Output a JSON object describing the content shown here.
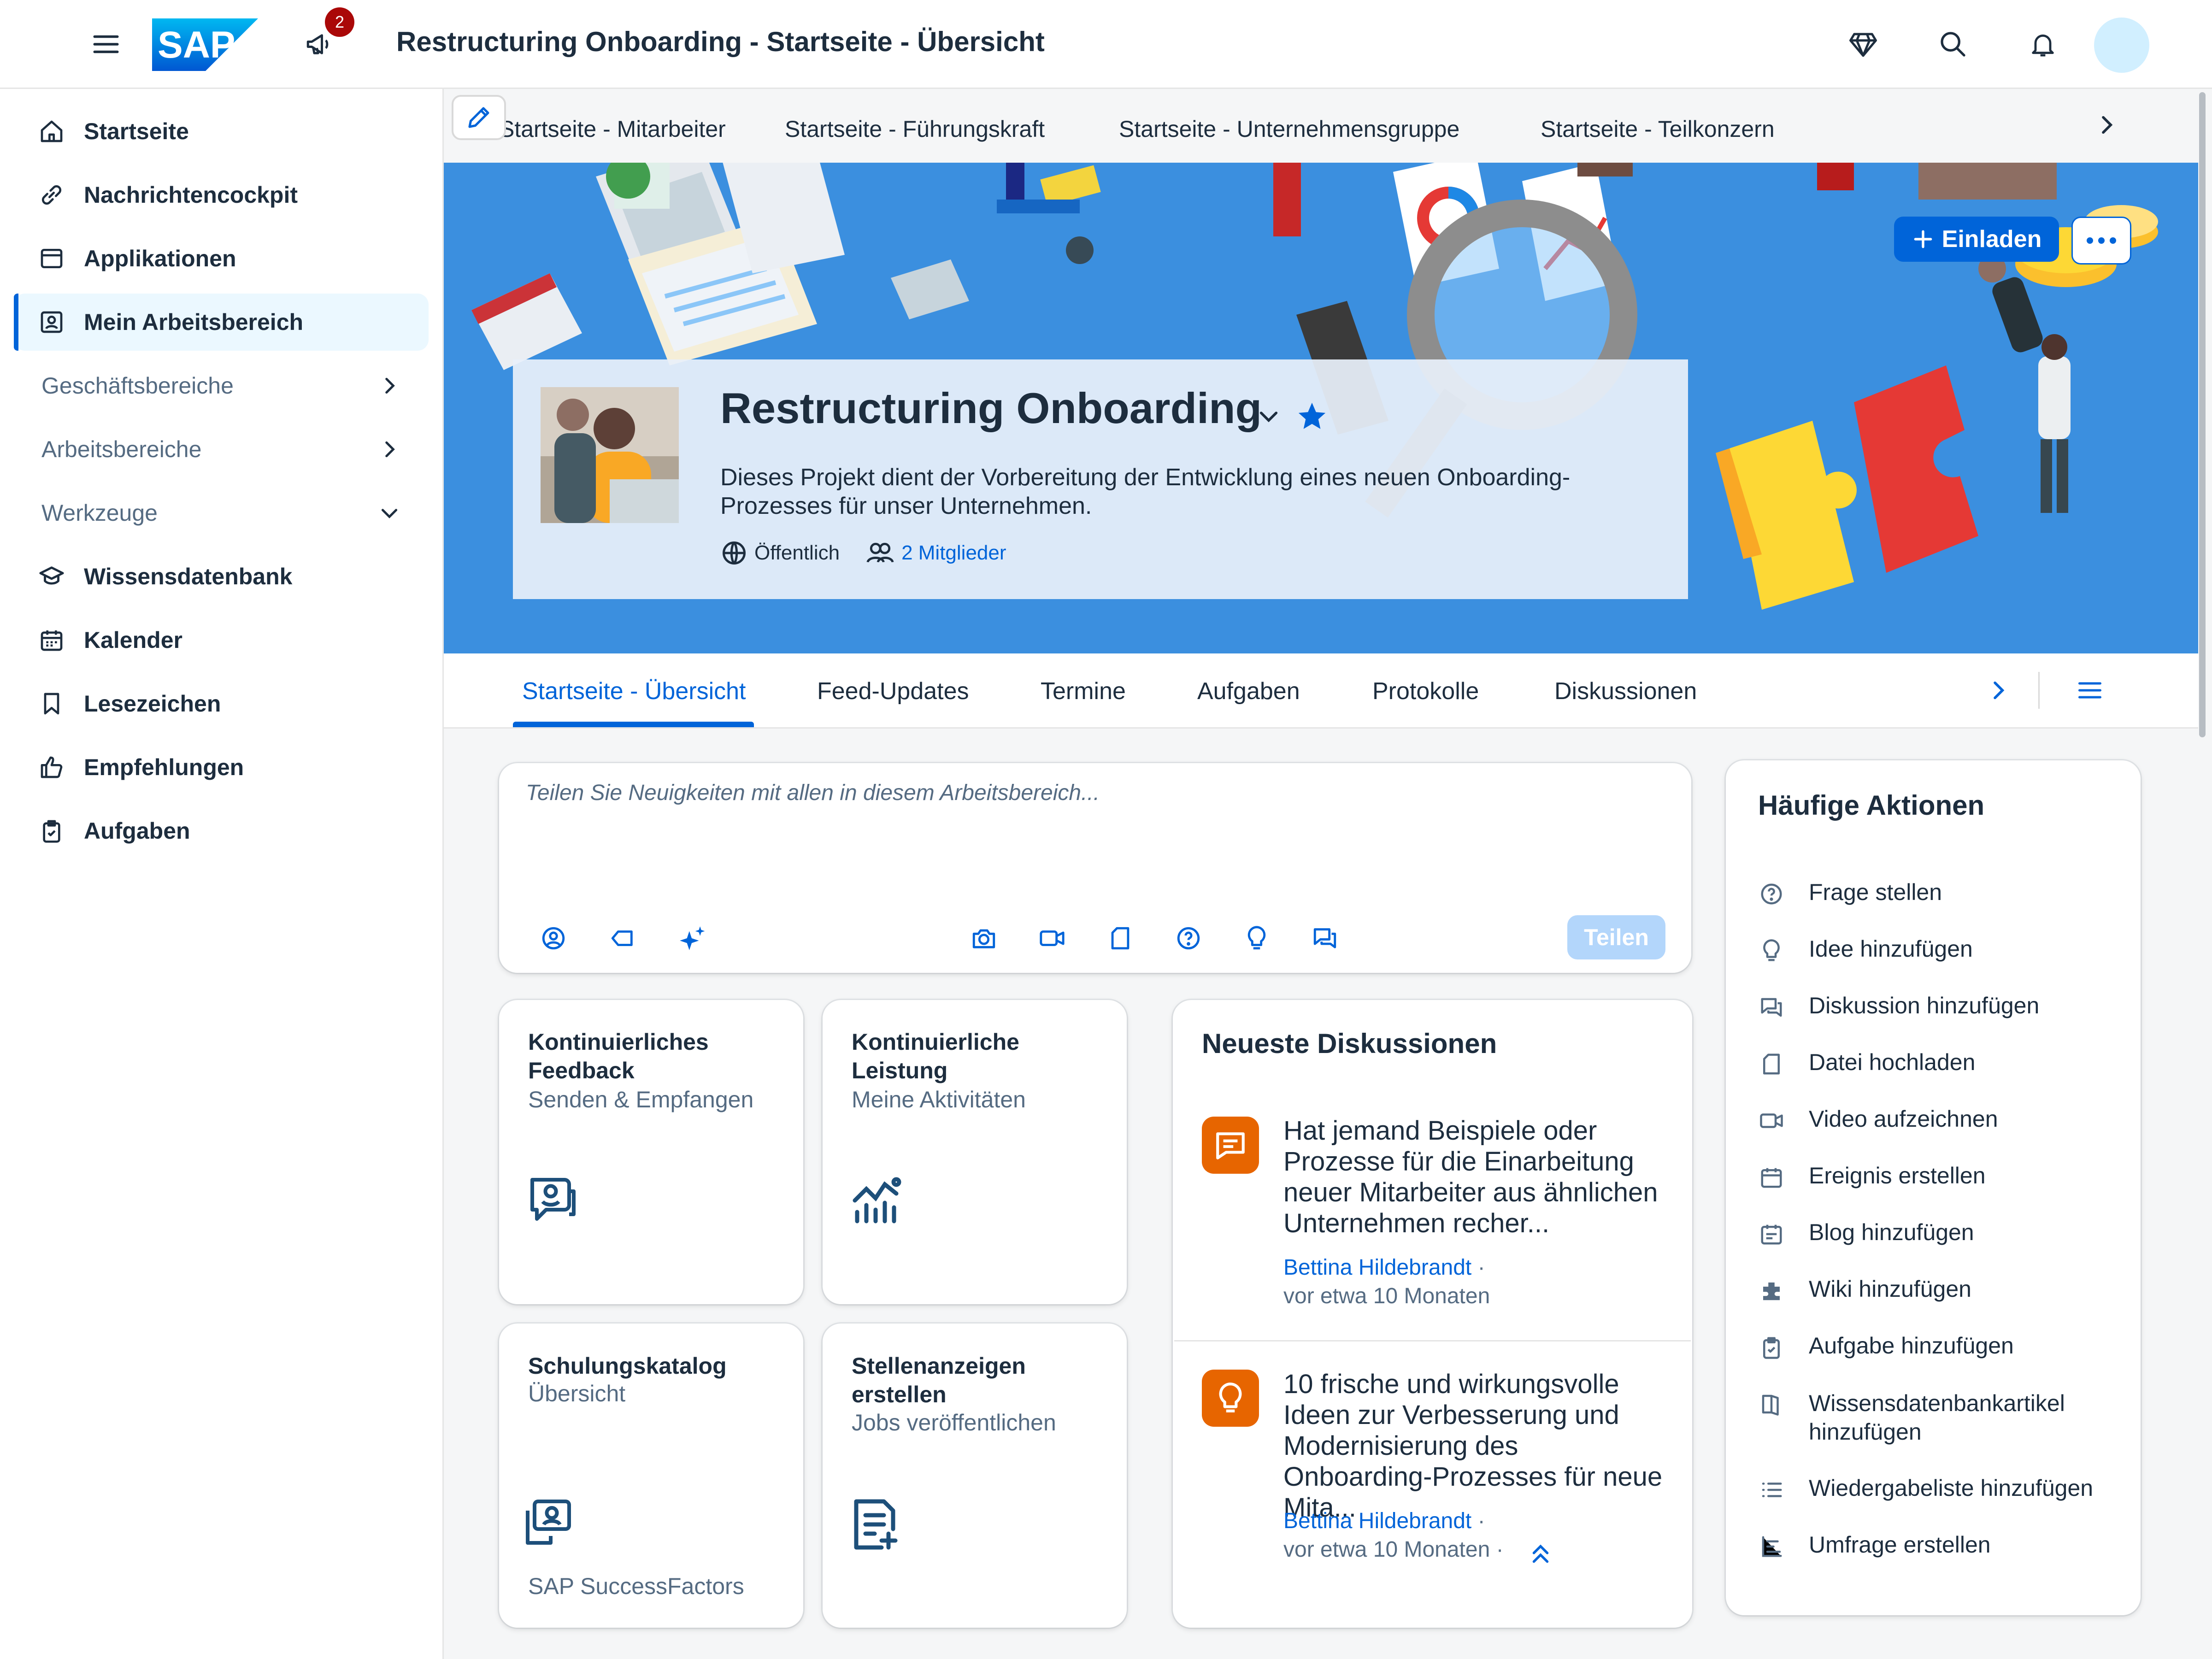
{
  "shell": {
    "title": "Restructuring Onboarding - Startseite - Übersicht",
    "logo_text": "SAP",
    "notification_count": "2",
    "accent": "#0064d9",
    "icons": [
      "menu-icon",
      "megaphone-icon",
      "diamond-icon",
      "search-icon",
      "bell-icon"
    ]
  },
  "sidebar": {
    "items": [
      {
        "label": "Startseite",
        "icon": "home-icon"
      },
      {
        "label": "Nachrichtencockpit",
        "icon": "link-icon"
      },
      {
        "label": "Applikationen",
        "icon": "app-window-icon"
      },
      {
        "label": "Mein Arbeitsbereich",
        "icon": "workspace-icon",
        "selected": true
      },
      {
        "label": "Geschäftsbereiche",
        "group": true,
        "chevron": "right"
      },
      {
        "label": "Arbeitsbereiche",
        "group": true,
        "chevron": "right"
      },
      {
        "label": "Werkzeuge",
        "group": true,
        "chevron": "down"
      },
      {
        "label": "Wissensdatenbank",
        "icon": "education-icon"
      },
      {
        "label": "Kalender",
        "icon": "calendar-icon"
      },
      {
        "label": "Lesezeichen",
        "icon": "bookmark-icon"
      },
      {
        "label": "Empfehlungen",
        "icon": "thumb-up-icon"
      },
      {
        "label": "Aufgaben",
        "icon": "task-icon"
      }
    ]
  },
  "subnav": {
    "tabs": [
      "Startseite - Mitarbeiter",
      "Startseite - Führungskraft",
      "Startseite - Unternehmensgruppe",
      "Startseite - Teilkonzern"
    ]
  },
  "workspace": {
    "title": "Restructuring Onboarding",
    "description": "Dieses Projekt dient der Vorbereitung der Entwicklung eines neuen Onboarding-Prozesses für unser Unternehmen.",
    "visibility": "Öffentlich",
    "members": "2 Mitglieder",
    "invite_label": "Einladen",
    "favorite": true
  },
  "tabs": {
    "items": [
      "Startseite - Übersicht",
      "Feed-Updates",
      "Termine",
      "Aufgaben",
      "Protokolle",
      "Diskussionen"
    ],
    "active": 0
  },
  "composer": {
    "placeholder": "Teilen Sie Neuigkeiten mit allen in diesem Arbeitsbereich...",
    "share_label": "Teilen"
  },
  "tiles": [
    {
      "title": "Kontinuierliches Feedback",
      "subtitle": "Senden & Empfangen",
      "icon": "feedback-icon",
      "footer": ""
    },
    {
      "title": "Kontinuierliche Leistung",
      "subtitle": "Meine Aktivitäten",
      "icon": "performance-chart-icon",
      "footer": ""
    },
    {
      "title": "Schulungskatalog",
      "subtitle": "Übersicht",
      "icon": "learning-icon",
      "footer": "SAP SuccessFactors"
    },
    {
      "title": "Stellenanzeigen erstellen",
      "subtitle": "Jobs veröffentlichen",
      "icon": "add-document-icon",
      "footer": ""
    }
  ],
  "discussions": {
    "title": "Neueste Diskussionen",
    "items": [
      {
        "text": "Hat jemand Beispiele oder Prozesse für die Einarbeitung neuer Mitarbeiter aus ähnlichen Unternehmen recher...",
        "author": "Bettina Hildebrandt",
        "time": "vor etwa 10 Monaten",
        "icon": "discussion-icon"
      },
      {
        "text": "10 frische und wirkungsvolle Ideen zur Verbesserung und Modernisierung des Onboarding-Prozesses für neue Mita...",
        "author": "Bettina Hildebrandt",
        "time": "vor etwa 10 Monaten",
        "icon": "idea-icon"
      }
    ]
  },
  "quick_actions": {
    "title": "Häufige Aktionen",
    "items": [
      {
        "label": "Frage stellen",
        "icon": "question-icon"
      },
      {
        "label": "Idee hinzufügen",
        "icon": "lightbulb-icon"
      },
      {
        "label": "Diskussion hinzufügen",
        "icon": "discussion-icon"
      },
      {
        "label": "Datei hochladen",
        "icon": "document-icon"
      },
      {
        "label": "Video aufzeichnen",
        "icon": "video-icon"
      },
      {
        "label": "Ereignis erstellen",
        "icon": "calendar-icon"
      },
      {
        "label": "Blog hinzufügen",
        "icon": "blog-icon"
      },
      {
        "label": "Wiki hinzufügen",
        "icon": "wiki-icon"
      },
      {
        "label": "Aufgabe hinzufügen",
        "icon": "task-icon"
      },
      {
        "label": "Wissensdatenbankartikel hinzufügen",
        "icon": "knowledge-icon"
      },
      {
        "label": "Wiedergabeliste hinzufügen",
        "icon": "list-icon"
      },
      {
        "label": "Umfrage erstellen",
        "icon": "survey-icon"
      }
    ]
  }
}
